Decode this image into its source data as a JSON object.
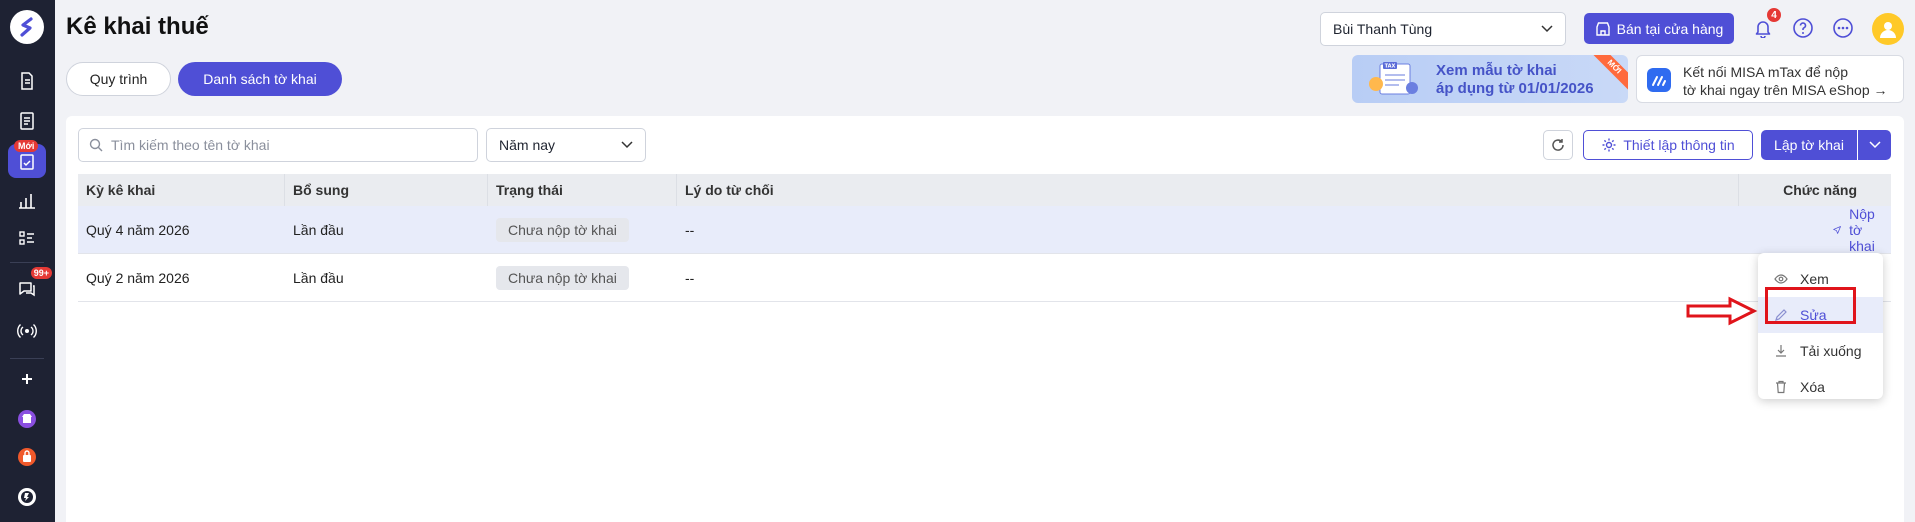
{
  "header": {
    "title": "Kê khai thuế",
    "tabs": [
      "Quy trình",
      "Danh sách tờ khai"
    ],
    "user_name": "Bùi Thanh Tùng",
    "store_button": "Bán tại cửa hàng",
    "notification_count": "4"
  },
  "sidebar": {
    "new_badge": "Mới",
    "chat_badge": "99+"
  },
  "promo": {
    "tax_line1": "Xem mẫu tờ khai",
    "tax_line2": "áp dụng từ 01/01/2026",
    "ribbon": "MỚI",
    "tax_tag": "TAX",
    "mtax_line1": "Kết nối MISA mTax để nộp",
    "mtax_line2": "tờ khai ngay trên MISA eShop →"
  },
  "toolbar": {
    "search_placeholder": "Tìm kiếm theo tên tờ khai",
    "year_filter": "Năm nay",
    "setup_button": "Thiết lập thông tin",
    "create_button": "Lập tờ khai"
  },
  "table": {
    "columns": [
      "Kỳ kê khai",
      "Bổ sung",
      "Trạng thái",
      "Lý do từ chối",
      "Chức năng"
    ],
    "rows": [
      {
        "period": "Quý 4 năm 2026",
        "supplement": "Lần đầu",
        "status": "Chưa nộp tờ khai",
        "reason": "--",
        "action": "Nộp tờ khai"
      },
      {
        "period": "Quý 2 năm 2026",
        "supplement": "Lần đầu",
        "status": "Chưa nộp tờ khai",
        "reason": "--"
      }
    ]
  },
  "menu": {
    "items": [
      "Xem",
      "Sửa",
      "Tải xuống",
      "Xóa"
    ]
  },
  "colors": {
    "primary": "#4f4fd6",
    "sidebar": "#1e2233",
    "highlight": "#e0141b"
  }
}
